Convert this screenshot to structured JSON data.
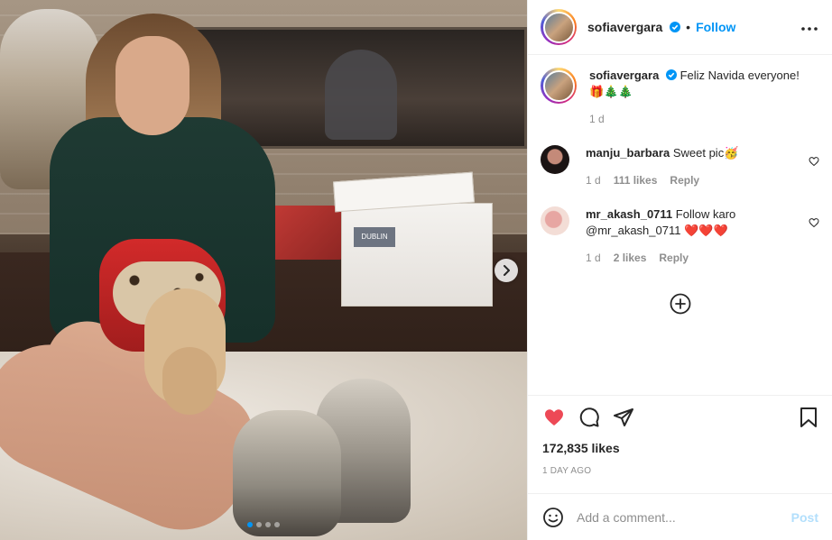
{
  "post": {
    "media": {
      "box_label": "DUBLIN",
      "next_icon": "chevron-right-icon",
      "slides_total": 4,
      "slide_active": 1
    },
    "header": {
      "username": "sofiavergara",
      "separator": "•",
      "follow_label": "Follow",
      "more_icon": "more-horizontal-icon"
    },
    "caption": {
      "username": "sofiavergara",
      "text": "Feliz Navida everyone!🎁🎄🎄",
      "age": "1 d"
    },
    "comments": [
      {
        "username": "manju_barbara",
        "text": "Sweet pic🥳",
        "age": "1 d",
        "likes": "111 likes",
        "reply_label": "Reply"
      },
      {
        "username": "mr_akash_0711",
        "text": "Follow karo @mr_akash_0711 ❤️❤️❤️",
        "age": "1 d",
        "likes": "2 likes",
        "reply_label": "Reply"
      }
    ],
    "likes": "172,835 likes",
    "posted": "1 DAY AGO",
    "add_comment": {
      "placeholder": "Add a comment...",
      "post_label": "Post"
    },
    "colors": {
      "accent": "#0095f6",
      "like_red": "#ed4956",
      "post_disabled": "#b2dffc",
      "muted": "#8e8e8e"
    }
  }
}
